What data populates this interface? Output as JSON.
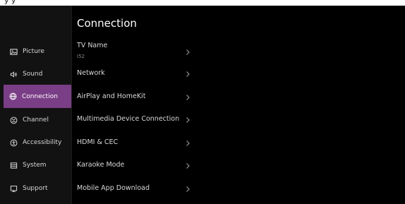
{
  "top_fragment": "y y",
  "sidebar": {
    "items": [
      {
        "label": "Picture",
        "icon": "picture-icon",
        "selected": false
      },
      {
        "label": "Sound",
        "icon": "sound-icon",
        "selected": false
      },
      {
        "label": "Connection",
        "icon": "globe-icon",
        "selected": true
      },
      {
        "label": "Channel",
        "icon": "channel-icon",
        "selected": false
      },
      {
        "label": "Accessibility",
        "icon": "accessibility-icon",
        "selected": false
      },
      {
        "label": "System",
        "icon": "system-icon",
        "selected": false
      },
      {
        "label": "Support",
        "icon": "support-icon",
        "selected": false
      }
    ],
    "selected_color": "#7a3e86"
  },
  "main": {
    "title": "Connection",
    "rows": [
      {
        "label": "TV Name",
        "value": "I52"
      },
      {
        "label": "Network"
      },
      {
        "label": "AirPlay and HomeKit"
      },
      {
        "label": "Multimedia Device Connection"
      },
      {
        "label": "HDMI & CEC"
      },
      {
        "label": "Karaoke Mode"
      },
      {
        "label": "Mobile App Download"
      }
    ]
  }
}
